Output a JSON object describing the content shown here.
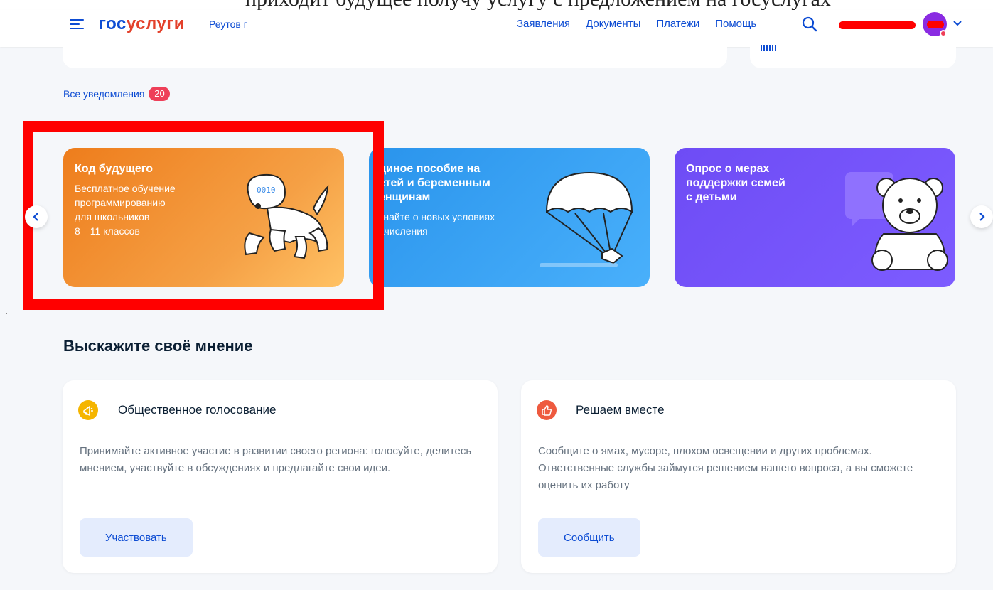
{
  "topstrip": {
    "text": "приходит будущее получу услугу с предложением на госуслугах"
  },
  "header": {
    "logo_part1": "гос",
    "logo_part2": "услуги",
    "city": "Реутов г",
    "nav": [
      "Заявления",
      "Документы",
      "Платежи",
      "Помощь"
    ],
    "accent_color": "#0d4cd3",
    "logo_accent": "#e3412b"
  },
  "notifications": {
    "label": "Все уведомления",
    "count": "20"
  },
  "banners": [
    {
      "title": "Код будущего",
      "subtitle_lines": [
        "Бесплатное обучение",
        "программированию",
        "для школьников",
        "8—11 классов"
      ],
      "icon": "robot-dog-icon"
    },
    {
      "title_lines": [
        "диное пособие на",
        "етей и беременным",
        "енщинам"
      ],
      "subtitle_lines": [
        "знайте о новых условиях",
        "ачисления"
      ],
      "icon": "parachute-icon"
    },
    {
      "title_lines": [
        "Опрос о мерах",
        "поддержки семей",
        "с детьми"
      ],
      "icon": "teddy-bear-icon"
    }
  ],
  "section": {
    "title": "Выскажите своё мнение"
  },
  "cards": [
    {
      "title": "Общественное голосование",
      "text": "Принимайте активное участие в развитии своего региона: голосуйте, делитесь мнением, участвуйте в обсуждениях и предлагайте свои идеи.",
      "button": "Участвовать",
      "icon": "megaphone-icon"
    },
    {
      "title": "Решаем вместе",
      "text": "Сообщите о ямах, мусоре, плохом освещении и других проблемах. Ответственные службы займутся решением вашего вопроса, а вы сможете оценить их работу",
      "button": "Сообщить",
      "icon": "thumbs-up-icon"
    }
  ]
}
